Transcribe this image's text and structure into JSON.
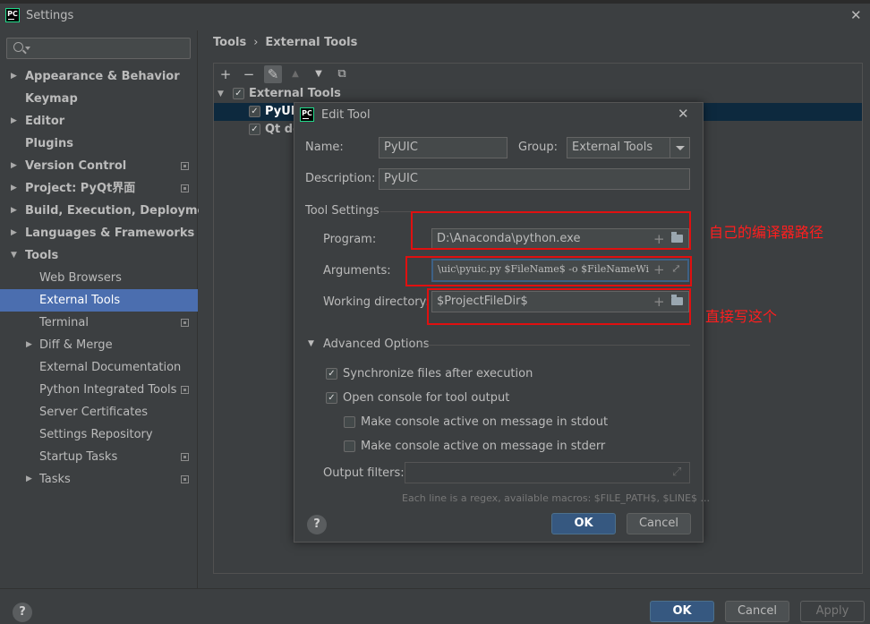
{
  "window": {
    "title": "Settings",
    "logo_text": "PC"
  },
  "sidebar": {
    "search_placeholder": "",
    "items": [
      {
        "label": "Appearance & Behavior",
        "level": 0,
        "arrow": "▶"
      },
      {
        "label": "Keymap",
        "level": 0
      },
      {
        "label": "Editor",
        "level": 0,
        "arrow": "▶"
      },
      {
        "label": "Plugins",
        "level": 0
      },
      {
        "label": "Version Control",
        "level": 0,
        "arrow": "▶",
        "project_icon": true
      },
      {
        "label": "Project: PyQt界面",
        "level": 0,
        "arrow": "▶",
        "project_icon": true
      },
      {
        "label": "Build, Execution, Deployment",
        "level": 0,
        "arrow": "▶"
      },
      {
        "label": "Languages & Frameworks",
        "level": 0,
        "arrow": "▶"
      },
      {
        "label": "Tools",
        "level": 0,
        "arrow": "▼"
      },
      {
        "label": "Web Browsers",
        "level": 1
      },
      {
        "label": "External Tools",
        "level": 1,
        "selected": true
      },
      {
        "label": "Terminal",
        "level": 1,
        "project_icon": true
      },
      {
        "label": "Diff & Merge",
        "level": 1,
        "arrow": "▶"
      },
      {
        "label": "External Documentation",
        "level": 1
      },
      {
        "label": "Python Integrated Tools",
        "level": 1,
        "project_icon": true
      },
      {
        "label": "Server Certificates",
        "level": 1
      },
      {
        "label": "Settings Repository",
        "level": 1
      },
      {
        "label": "Startup Tasks",
        "level": 1,
        "project_icon": true
      },
      {
        "label": "Tasks",
        "level": 1,
        "arrow": "▶",
        "project_icon": true
      }
    ]
  },
  "breadcrumb": {
    "parent": "Tools",
    "separator": "›",
    "current": "External Tools"
  },
  "toolbar": {
    "add": "+",
    "remove": "−",
    "edit": "✎",
    "up": "▲",
    "down": "▼",
    "copy": "⧉"
  },
  "tree": {
    "group": {
      "label": "External Tools",
      "arrow": "▼",
      "checked": "✓"
    },
    "items": [
      {
        "label": "PyUIC",
        "checked": "✓"
      },
      {
        "label": "Qt de",
        "checked": "✓"
      }
    ]
  },
  "dialog": {
    "title": "Edit Tool",
    "close": "✕",
    "name_label": "Name:",
    "name_value": "PyUIC",
    "group_label": "Group:",
    "group_value": "External Tools",
    "description_label": "Description:",
    "description_value": "PyUIC",
    "tool_settings_label": "Tool Settings",
    "program_label": "Program:",
    "program_value": "D:\\Anaconda\\python.exe",
    "arguments_label": "Arguments:",
    "arguments_value": "\\uic\\pyuic.py $FileName$ -o $FileNameWi",
    "working_dir_label": "Working directory:",
    "working_dir_value": "$ProjectFileDir$",
    "advanced_label": "Advanced Options",
    "advanced_arrow": "▼",
    "options": [
      {
        "label": "Synchronize files after execution",
        "checked": "✓"
      },
      {
        "label": "Open console for tool output",
        "checked": "✓"
      },
      {
        "label": "Make console active on message in stdout",
        "checked": ""
      },
      {
        "label": "Make console active on message in stderr",
        "checked": ""
      }
    ],
    "output_filters_label": "Output filters:",
    "output_filters_value": "",
    "hint": "Each line is a regex, available macros: $FILE_PATH$, $LINE$ ...",
    "help": "?",
    "ok": "OK",
    "cancel": "Cancel",
    "field_plus": "+",
    "field_expand": "⤢"
  },
  "annotations": {
    "program_note": "自己的编译器路径",
    "workdir_note": "直接写这个"
  },
  "bottom": {
    "help": "?",
    "ok": "OK",
    "cancel": "Cancel",
    "apply": "Apply"
  },
  "colors": {
    "accent": "#4b6eaf",
    "primary_button": "#365880",
    "annotation": "#e01010"
  }
}
